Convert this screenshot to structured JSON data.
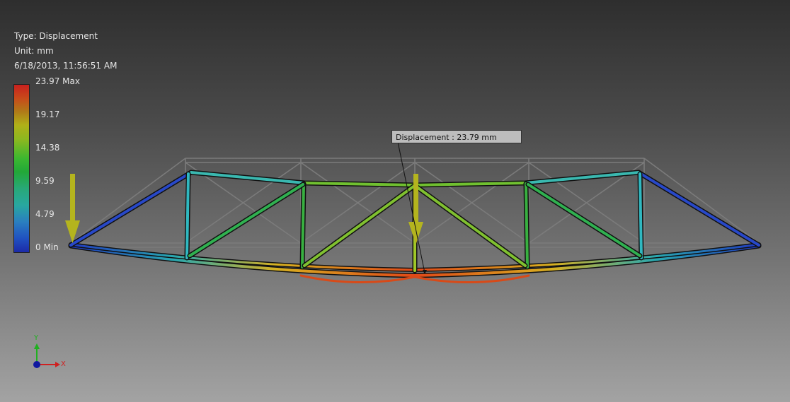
{
  "result_info": {
    "type": "Type: Displacement",
    "unit": "Unit: mm",
    "datetime": "6/18/2013, 11:56:51 AM"
  },
  "legend": {
    "labels": [
      "23.97 Max",
      "19.17",
      "14.38",
      "9.59",
      "4.79",
      "0 Min"
    ],
    "colors": {
      "max": "#c8201e",
      "min": "#1c2aa8"
    }
  },
  "probe": {
    "text": "Displacement : 23.79 mm"
  },
  "triad": {
    "x_label": "X",
    "y_label": "Y"
  },
  "load_arrow_color": "#b4b41e"
}
